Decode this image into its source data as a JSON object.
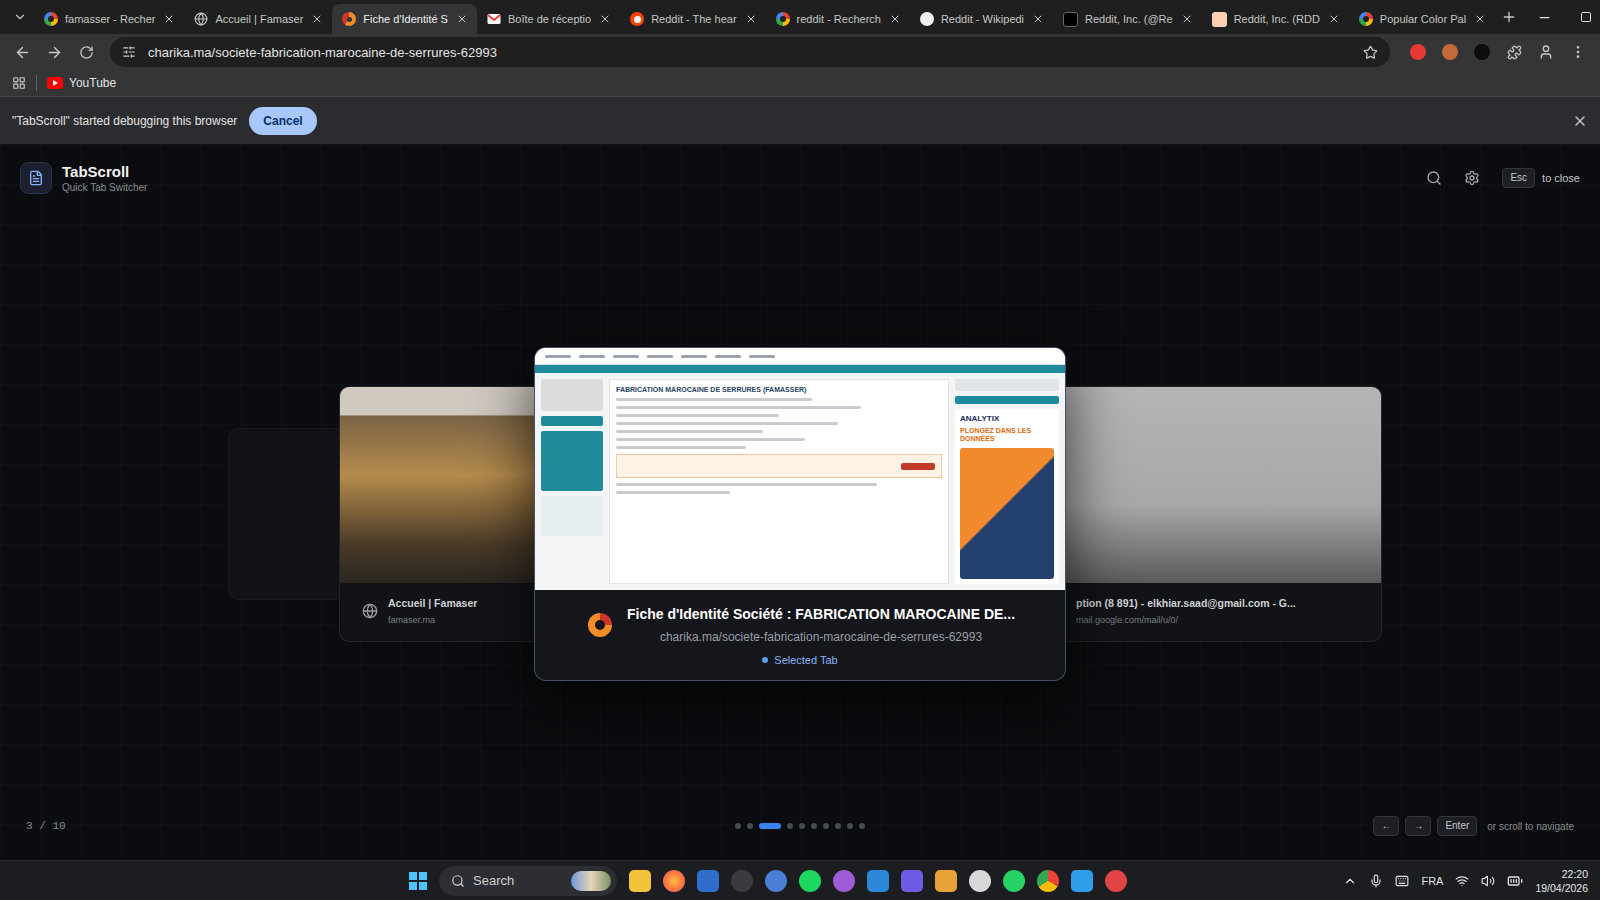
{
  "browser": {
    "tabs": [
      {
        "label": "famasser - Recher",
        "kind": "google",
        "selected": false
      },
      {
        "label": "Accueil | Famaser",
        "kind": "site",
        "selected": false
      },
      {
        "label": "Fiche d'Identité S",
        "kind": "charika",
        "selected": true
      },
      {
        "label": "Boîte de réceptio",
        "kind": "gmail",
        "selected": false
      },
      {
        "label": "Reddit - The hear",
        "kind": "reddit",
        "selected": false
      },
      {
        "label": "reddit - Recherch",
        "kind": "google",
        "selected": false
      },
      {
        "label": "Reddit - Wikipedi",
        "kind": "wikipedia",
        "selected": false
      },
      {
        "label": "Reddit, Inc. (@Re",
        "kind": "x",
        "selected": false
      },
      {
        "label": "Reddit, Inc. (RDD",
        "kind": "ft",
        "selected": false
      },
      {
        "label": "Popular Color Pal",
        "kind": "google",
        "selected": false
      }
    ],
    "url": "charika.ma/societe-fabrication-marocaine-de-serrures-62993",
    "bookmarks": [
      {
        "label": "YouTube"
      }
    ],
    "infobar": {
      "message": "\"TabScroll\" started debugging this browser",
      "button": "Cancel"
    }
  },
  "switcher": {
    "title": "TabScroll",
    "subtitle": "Quick Tab Switcher",
    "close_key": "Esc",
    "close_label": "to close",
    "cards": [
      {
        "kind": "previous",
        "title": "Accueil | Famaser",
        "url": "famaser.ma",
        "selected": false
      },
      {
        "kind": "current",
        "title": "Fiche d'Identité Société : FABRICATION MAROCAINE DE...",
        "url": "charika.ma/societe-fabrication-marocaine-de-serrures-62993",
        "selected": true,
        "badge": "Selected Tab",
        "preview": {
          "heading": "FABRICATION MAROCAINE DE SERRURES (FAMASSER)",
          "ad_brand": "ANALYTIX",
          "ad_text": "PLONGEZ DANS LES DONNÉES"
        }
      },
      {
        "kind": "next",
        "title": "ption (8 891) - elkhiar.saad@gmail.com - G...",
        "url": "mail.google.com/mail/u/0/",
        "selected": false
      }
    ],
    "counter": "3 / 10",
    "dots": [
      {
        "selected": false
      },
      {
        "selected": false
      },
      {
        "selected": true
      },
      {
        "selected": false
      },
      {
        "selected": false
      },
      {
        "selected": false
      },
      {
        "selected": false
      },
      {
        "selected": false
      },
      {
        "selected": false
      },
      {
        "selected": false
      }
    ],
    "keys": [
      "←",
      "→",
      "Enter"
    ],
    "hint": "or scroll to navigate"
  },
  "taskbar": {
    "search": "Search",
    "language": "FRA",
    "time": "22:20",
    "date": "19/04/2026"
  }
}
